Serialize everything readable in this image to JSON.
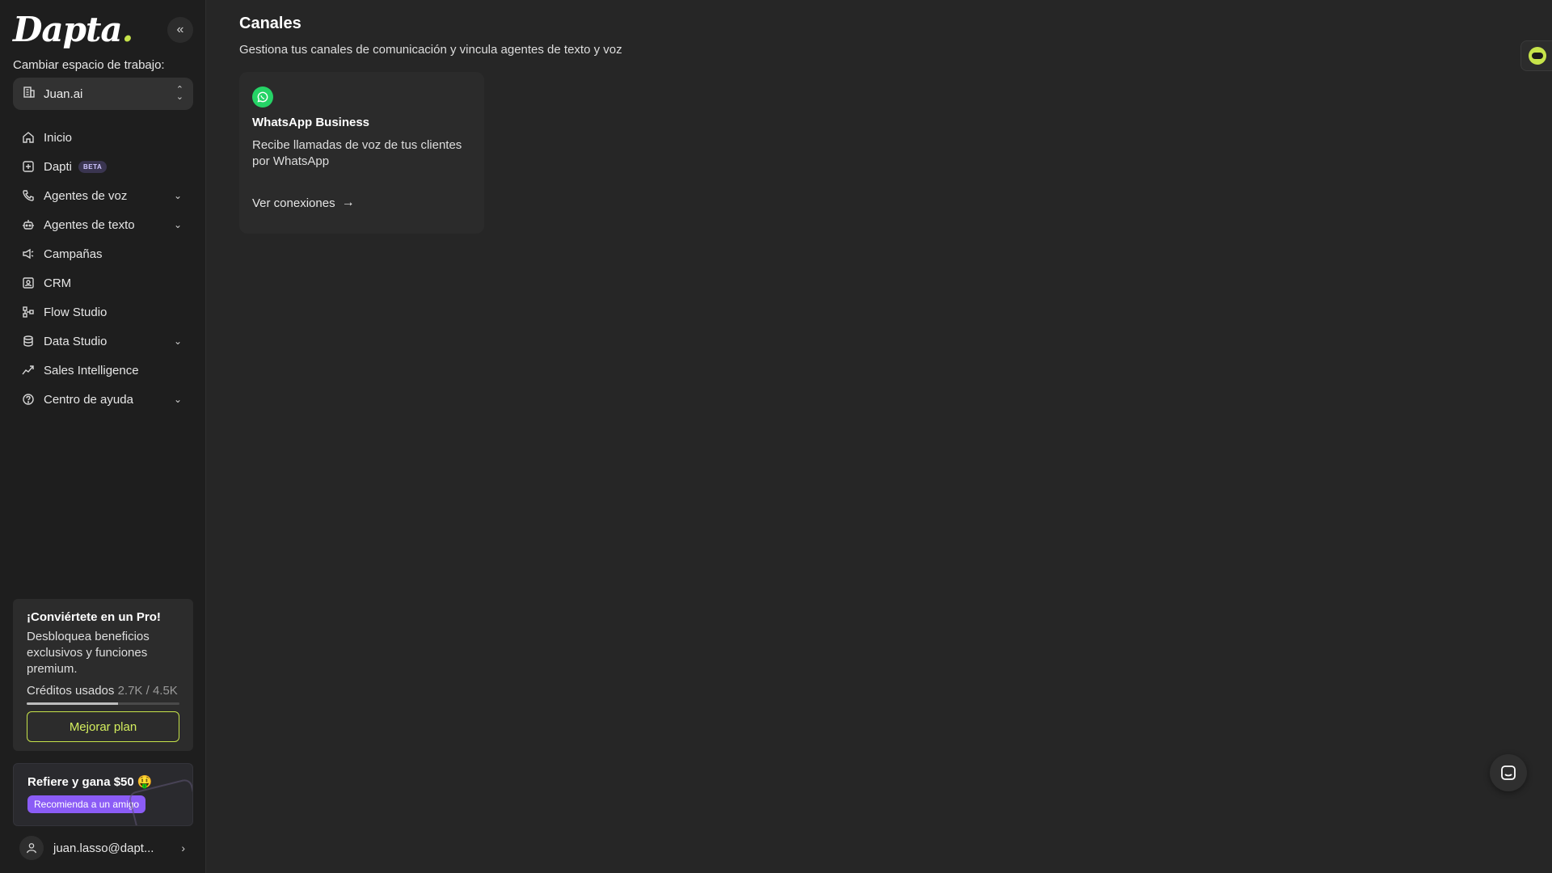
{
  "brand": {
    "logo_text": "Dapta",
    "logo_dot": ".",
    "accent": "#c6e34a"
  },
  "sidebar": {
    "workspace_label": "Cambiar espacio de trabajo:",
    "workspace_name": "Juan.ai",
    "items": [
      {
        "label": "Inicio",
        "icon": "home-icon"
      },
      {
        "label": "Dapti",
        "icon": "dapti-icon",
        "badge": "BETA"
      },
      {
        "label": "Agentes de voz",
        "icon": "phone-icon",
        "expandable": true
      },
      {
        "label": "Agentes de texto",
        "icon": "bot-icon",
        "expandable": true
      },
      {
        "label": "Campañas",
        "icon": "megaphone-icon"
      },
      {
        "label": "CRM",
        "icon": "contact-icon"
      },
      {
        "label": "Flow Studio",
        "icon": "flow-icon"
      },
      {
        "label": "Data Studio",
        "icon": "database-icon",
        "expandable": true
      },
      {
        "label": "Sales Intelligence",
        "icon": "trend-icon"
      },
      {
        "label": "Centro de ayuda",
        "icon": "help-icon",
        "expandable": true
      }
    ],
    "pro": {
      "title": "¡Conviértete en un Pro!",
      "description": "Desbloquea beneficios exclusivos y funciones premium.",
      "credits_label": "Créditos usados",
      "credits_amount": "2.7K / 4.5K",
      "credits_fraction": 0.6,
      "button": "Mejorar plan"
    },
    "referral": {
      "title": "Refiere y gana $50 🤑",
      "button": "Recomienda a un amigo"
    },
    "user_email": "juan.lasso@dapt..."
  },
  "main": {
    "title": "Canales",
    "subtitle": "Gestiona tus canales de comunicación y vincula agentes de texto y voz",
    "cards": [
      {
        "icon": "whatsapp-icon",
        "title": "WhatsApp Business",
        "description": "Recibe llamadas de voz de tus clientes por WhatsApp",
        "link": "Ver conexiones"
      }
    ]
  }
}
